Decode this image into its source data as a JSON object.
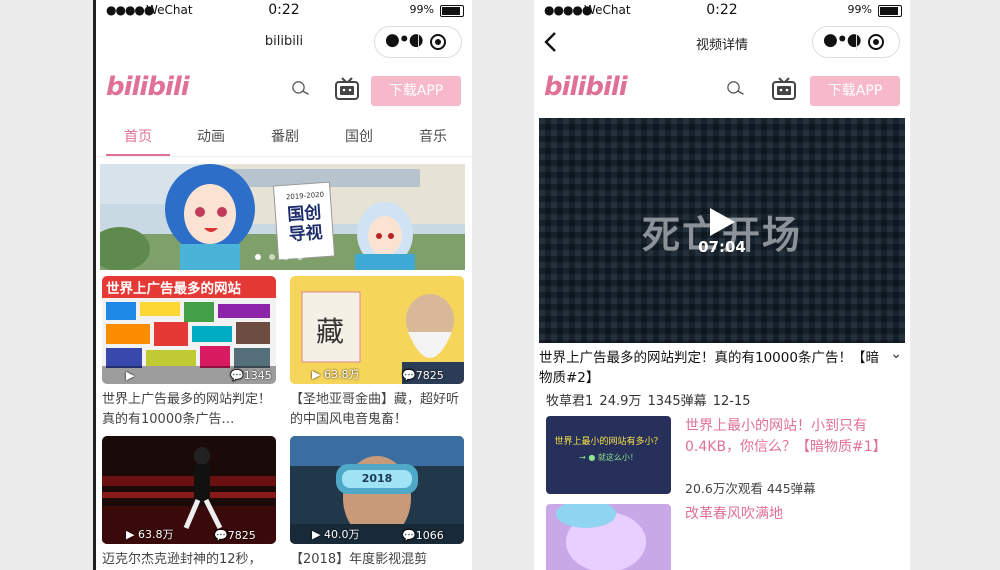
{
  "status_bar": {
    "signal": "●●●●●",
    "carrier": "WeChat",
    "time": "0:22",
    "battery": "99%"
  },
  "left": {
    "nav_title": "bilibili",
    "logo": "bilibili",
    "download_label": "下载APP",
    "tabs": [
      "首页",
      "动画",
      "番剧",
      "国创",
      "音乐"
    ],
    "banner": {
      "sign_year": "2019-2020",
      "sign_text": "国创导视"
    },
    "cards": [
      {
        "thumb_caption": "世界上广告最多的网站",
        "plays": "",
        "danmaku": "1345",
        "title": "世界上广告最多的网站判定！真的有10000条广告…"
      },
      {
        "thumb_caption": "藏",
        "plays": "63.8万",
        "danmaku": "7825",
        "title": "【圣地亚哥金曲】藏，超好听的中国风电音鬼畜！"
      },
      {
        "thumb_caption": "",
        "plays": "63.8万",
        "danmaku": "7825",
        "title": "迈克尔杰克逊封神的12秒，"
      },
      {
        "thumb_caption": "2018",
        "plays": "40.0万",
        "danmaku": "1066",
        "title": "【2018】年度影视混剪"
      }
    ]
  },
  "right": {
    "nav_title": "视频详情",
    "logo": "bilibili",
    "download_label": "下载APP",
    "video": {
      "overlay_text": "死亡开场",
      "duration": "07:04"
    },
    "title": "世界上广告最多的网站判定！真的有10000条广告！【暗物质#2】",
    "author": "牧草君1",
    "views": "24.9万",
    "danmaku": "1345弹幕",
    "date": "12-15",
    "related": [
      {
        "title": "世界上最小的网站！小到只有0.4KB，你信么？【暗物质#1】",
        "thumb_caption": "世界上最小的网站有多小？",
        "thumb_sub": "→ ● 就这么小！",
        "views": "20.6万次观看",
        "danmaku": "445弹幕"
      },
      {
        "title": "改革春风吹满地"
      }
    ]
  },
  "colors": {
    "brand_pink": "#e17095",
    "download_bg": "#f7b9c9"
  }
}
